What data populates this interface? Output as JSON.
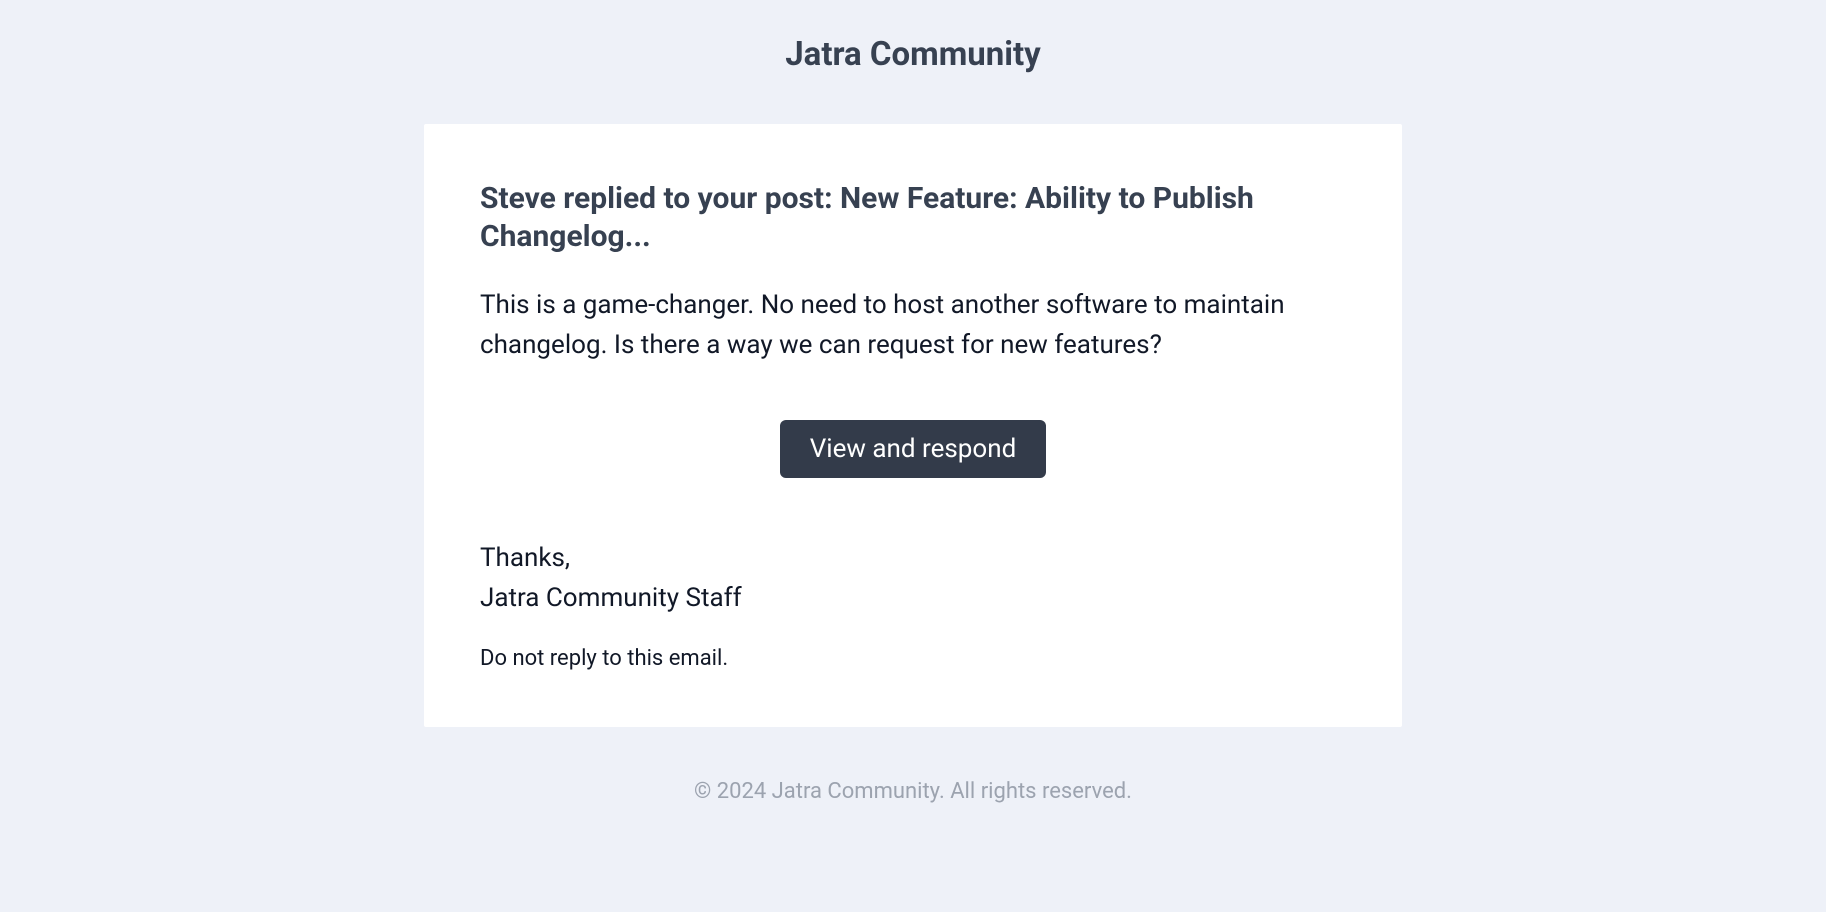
{
  "header": {
    "title": "Jatra Community"
  },
  "email": {
    "subject": "Steve replied to your post: New Feature: Ability to Publish Changelog...",
    "body": "This is a game-changer. No need to host another software to maintain changelog. Is there a way we can request for new features?",
    "cta_label": "View and respond",
    "signoff_thanks": "Thanks,",
    "signoff_from": "Jatra Community Staff",
    "noreply": "Do not reply to this email."
  },
  "footer": {
    "copyright": "© 2024 Jatra Community. All rights reserved."
  }
}
